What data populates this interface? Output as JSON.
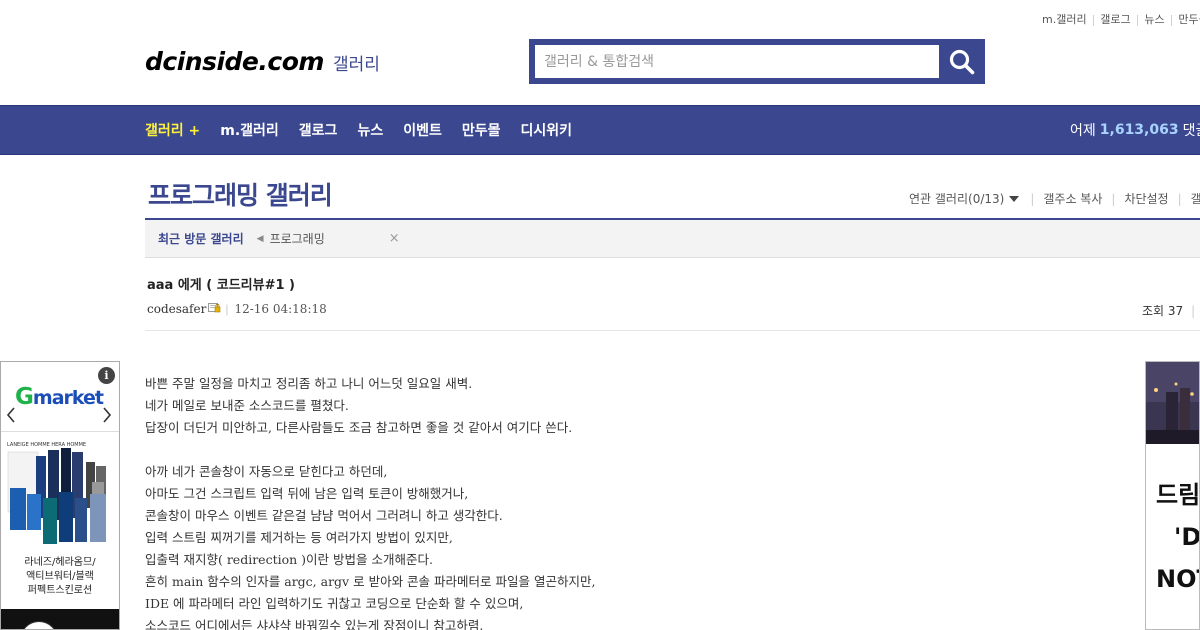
{
  "top_links": [
    "m.갤러리",
    "갤로그",
    "뉴스",
    "만두몰"
  ],
  "logo": {
    "brand": "dcinside.com",
    "sub": "갤러리"
  },
  "search": {
    "placeholder": "갤러리 & 통합검색"
  },
  "nav": {
    "items": [
      "갤러리 +",
      "m.갤러리",
      "갤로그",
      "뉴스",
      "이벤트",
      "만두몰",
      "디시위키"
    ],
    "stats_label": "어제",
    "stats_value": "1,613,063",
    "stats_suffix": "댓글"
  },
  "gallery": {
    "title": "프로그래밍 갤러리",
    "options": [
      "연관 갤러리(0/13)",
      "갤주소 복사",
      "차단설정",
      "갤러리"
    ]
  },
  "recent_visit": {
    "label": "최근 방문 갤러리",
    "items": [
      "프로그래밍"
    ],
    "close": "×"
  },
  "post": {
    "title": "aaa 에게 ( 코드리뷰#1 )",
    "author": "codesafer",
    "date": "12-16 04:18:18",
    "views_label": "조회 37",
    "body": [
      "바쁜 주말 일정을 마치고 정리좀 하고 나니 어느덧 일요일 새벽.",
      "네가 메일로 보내준 소스코드를 펼쳤다.",
      "답장이 더딘거 미안하고, 다른사람들도 조금 참고하면 좋을 것 같아서 여기다 쓴다.",
      "",
      "아까 네가 콘솔창이 자동으로 닫힌다고 하던데,",
      "아마도 그건 스크립트 입력 뒤에 남은 입력 토큰이 방해했거나,",
      "콘솔창이 마우스 이벤트 같은걸 냠냠 먹어서 그러려니 하고 생각한다.",
      "입력 스트림 찌꺼기를 제거하는 등 여러가지 방법이 있지만,",
      "입출력 재지향( redirection )이란 방법을 소개해준다.",
      "흔히 main 함수의 인자를 argc, argv 로 받아와 콘솔 파라메터로 파일을 열곤하지만,",
      "IDE 에 파라메터 라인 입력하기도 귀찮고 코딩으로 단순화 할 수 있으며,",
      "소스코드 어디에서든 샤샤샥 바꿔낄수 있는게 장점이니 참고하렴."
    ]
  },
  "ad_left": {
    "brand_g": "G",
    "brand_rest": "market",
    "product_lines": [
      "라네즈/헤라옴므/",
      "액티브워터/블랙",
      "퍼펙트스킨로션"
    ],
    "product_box_text": "LANEIGE HOMME HERA HOMME"
  },
  "ad_right": {
    "lines": [
      "드림",
      "'D",
      "NOT"
    ]
  },
  "colors": {
    "brand_blue": "#3b4890",
    "nav_active": "#fff23d",
    "stat_number": "#a9d3ff"
  }
}
